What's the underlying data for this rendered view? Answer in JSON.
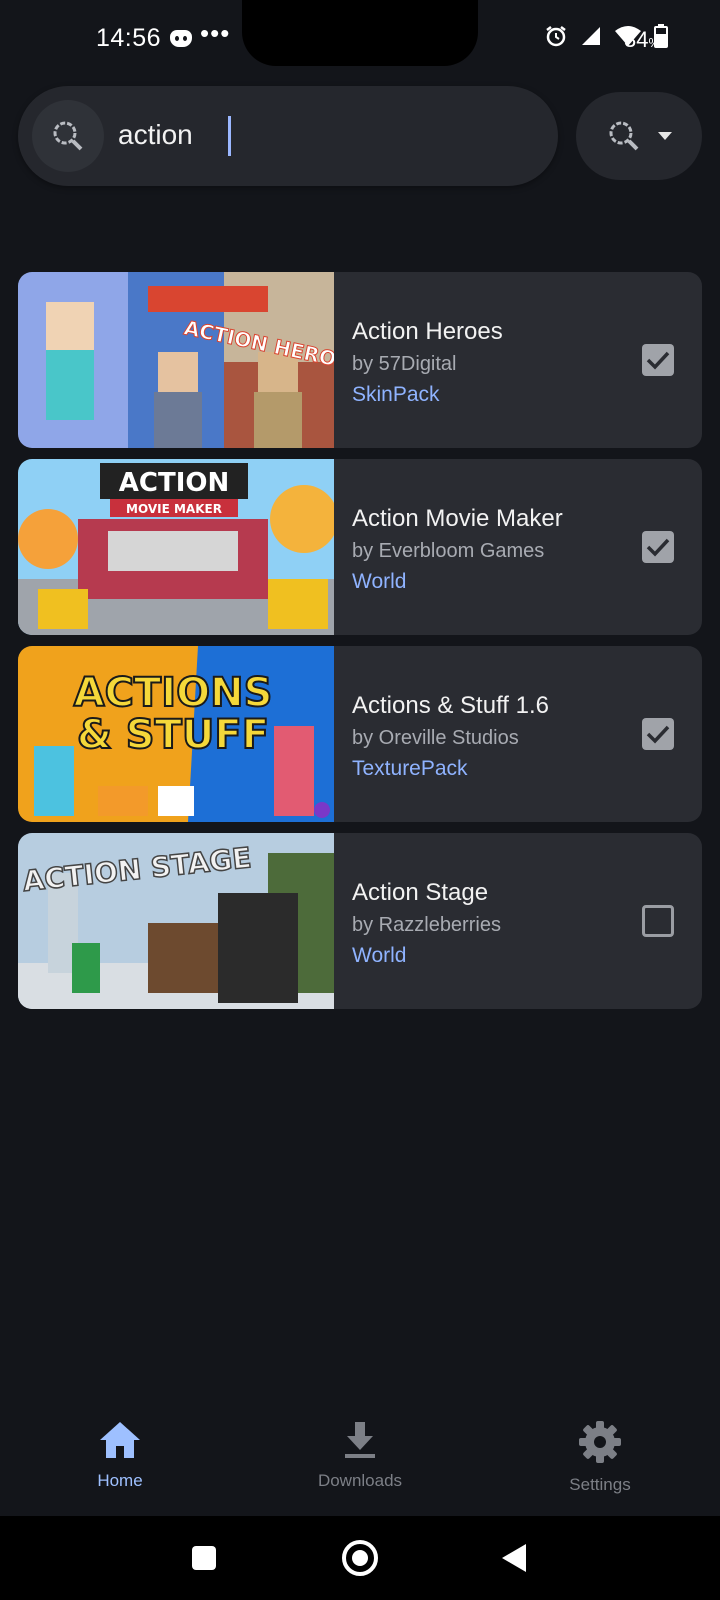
{
  "status_bar": {
    "time": "14:56",
    "more": "•••",
    "battery_percent": "34",
    "battery_unit": "%"
  },
  "search": {
    "value": "action",
    "filter_icon": "search-filter-icon"
  },
  "results": [
    {
      "title": "Action Heroes",
      "author": "by 57Digital",
      "type": "SkinPack",
      "checked": true,
      "thumb_colors": [
        "#8fa6e8",
        "#4a78c8",
        "#c7b59a"
      ]
    },
    {
      "title": "Action Movie Maker",
      "author": "by Everbloom Games",
      "type": "World",
      "checked": true,
      "thumb_colors": [
        "#8fd0f5",
        "#b63a4f",
        "#e9a23a"
      ]
    },
    {
      "title": "Actions & Stuff 1.6",
      "author": "by Oreville Studios",
      "type": "TexturePack",
      "checked": true,
      "thumb_colors": [
        "#f0a21c",
        "#1d6fd6",
        "#f5d83a"
      ]
    },
    {
      "title": "Action Stage",
      "author": "by Razzleberries",
      "type": "World",
      "checked": false,
      "thumb_colors": [
        "#b7cde0",
        "#4d6b3a",
        "#2b2b2b"
      ]
    }
  ],
  "thumb_text": [
    "ACTION HEROES",
    "ACTION",
    "MOVIE MAKER",
    "ACTIONS",
    "& STUFF",
    "ACTION STAGE"
  ],
  "bottom_nav": [
    {
      "label": "Home",
      "icon": "home-icon",
      "active": true
    },
    {
      "label": "Downloads",
      "icon": "download-icon",
      "active": false
    },
    {
      "label": "Settings",
      "icon": "gear-icon",
      "active": false
    }
  ],
  "colors": {
    "background": "#13151a",
    "card": "#2a2c32",
    "accent": "#9ec0ff",
    "type_link": "#8fb3ff"
  }
}
